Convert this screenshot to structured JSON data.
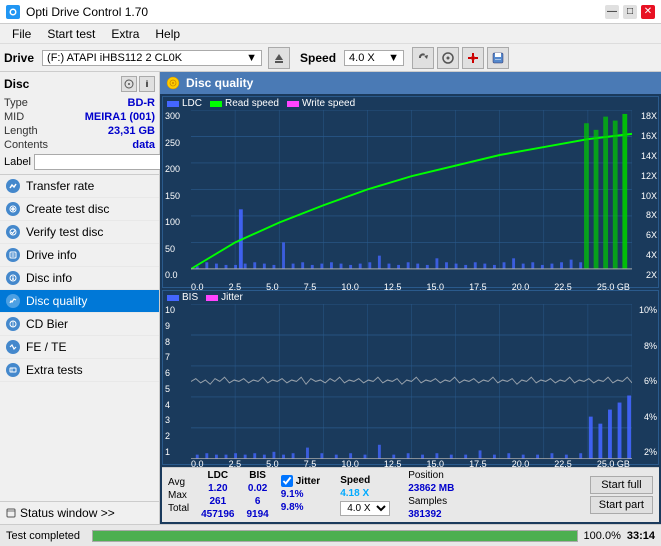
{
  "titlebar": {
    "title": "Opti Drive Control 1.70",
    "minimize": "—",
    "maximize": "□",
    "close": "✕"
  },
  "menubar": {
    "items": [
      "File",
      "Start test",
      "Extra",
      "Help"
    ]
  },
  "drivebar": {
    "label": "Drive",
    "drive_text": "(F:)  ATAPI iHBS112  2 CL0K",
    "speed_label": "Speed",
    "speed_value": "4.0 X"
  },
  "disc": {
    "title": "Disc",
    "type_label": "Type",
    "type_value": "BD-R",
    "mid_label": "MID",
    "mid_value": "MEIRA1 (001)",
    "length_label": "Length",
    "length_value": "23,31 GB",
    "contents_label": "Contents",
    "contents_value": "data",
    "label_label": "Label"
  },
  "nav": {
    "items": [
      {
        "id": "transfer-rate",
        "label": "Transfer rate",
        "active": false
      },
      {
        "id": "create-test-disc",
        "label": "Create test disc",
        "active": false
      },
      {
        "id": "verify-test-disc",
        "label": "Verify test disc",
        "active": false
      },
      {
        "id": "drive-info",
        "label": "Drive info",
        "active": false
      },
      {
        "id": "disc-info",
        "label": "Disc info",
        "active": false
      },
      {
        "id": "disc-quality",
        "label": "Disc quality",
        "active": true
      },
      {
        "id": "cd-bier",
        "label": "CD Bier",
        "active": false
      },
      {
        "id": "fe-te",
        "label": "FE / TE",
        "active": false
      },
      {
        "id": "extra-tests",
        "label": "Extra tests",
        "active": false
      }
    ]
  },
  "status_window": {
    "label": "Status window >>"
  },
  "content": {
    "title": "Disc quality"
  },
  "chart1": {
    "legend": {
      "ldc": "LDC",
      "read_speed": "Read speed",
      "write_speed": "Write speed"
    },
    "y_labels_left": [
      "300",
      "250",
      "200",
      "150",
      "100",
      "50",
      "0.0"
    ],
    "y_labels_right": [
      "18X",
      "16X",
      "14X",
      "12X",
      "10X",
      "8X",
      "6X",
      "4X",
      "2X"
    ],
    "x_labels": [
      "0.0",
      "2.5",
      "5.0",
      "7.5",
      "10.0",
      "12.5",
      "15.0",
      "17.5",
      "20.0",
      "22.5",
      "25.0 GB"
    ]
  },
  "chart2": {
    "legend": {
      "bis": "BIS",
      "jitter": "Jitter"
    },
    "y_labels_left": [
      "10",
      "9",
      "8",
      "7",
      "6",
      "5",
      "4",
      "3",
      "2",
      "1"
    ],
    "y_labels_right": [
      "10%",
      "8%",
      "6%",
      "4%",
      "2%"
    ],
    "x_labels": [
      "0.0",
      "2.5",
      "5.0",
      "7.5",
      "10.0",
      "12.5",
      "15.0",
      "17.5",
      "20.0",
      "22.5",
      "25.0 GB"
    ]
  },
  "stats": {
    "ldc_header": "LDC",
    "bis_header": "BIS",
    "jitter_header": "Jitter",
    "speed_header": "Speed",
    "avg_label": "Avg",
    "max_label": "Max",
    "total_label": "Total",
    "ldc_avg": "1.20",
    "ldc_max": "261",
    "ldc_total": "457196",
    "bis_avg": "0.02",
    "bis_max": "6",
    "bis_total": "9194",
    "jitter_avg": "9.1%",
    "jitter_max": "9.8%",
    "jitter_total": "",
    "speed_value": "4.18 X",
    "speed_unit": "4.0 X",
    "position_label": "Position",
    "position_value": "23862 MB",
    "samples_label": "Samples",
    "samples_value": "381392",
    "start_full_label": "Start full",
    "start_part_label": "Start part",
    "jitter_checkbox": "✓"
  },
  "bottom": {
    "status_text": "Test completed",
    "progress": 100,
    "time": "33:14"
  }
}
